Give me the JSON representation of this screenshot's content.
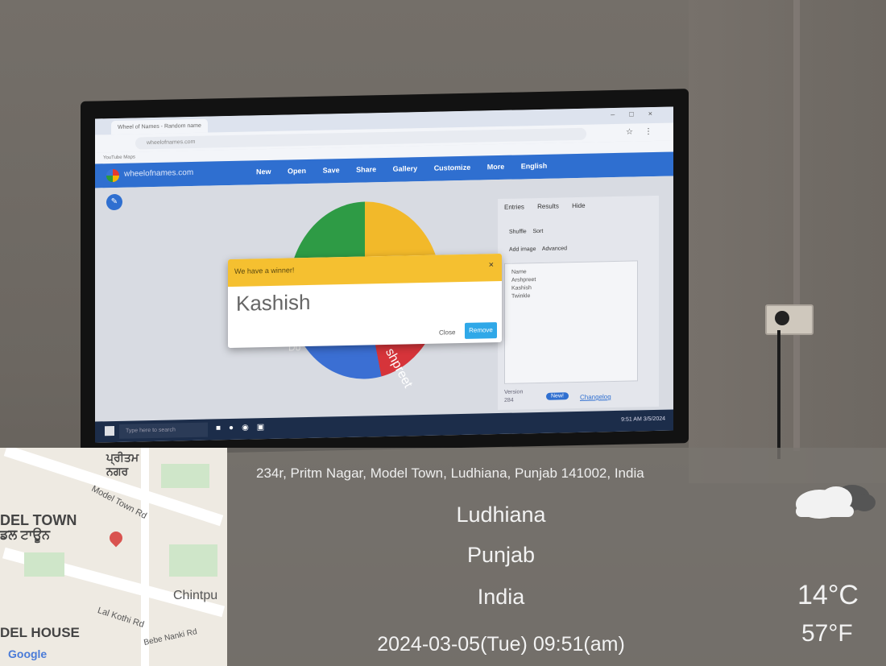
{
  "browser": {
    "tab_title": "Wheel of Names - Random name",
    "url": "wheelofnames.com",
    "bookmarks": "YouTube  Maps"
  },
  "app": {
    "site_name": "wheelofnames.com",
    "menu": [
      "New",
      "Open",
      "Save",
      "Share",
      "Gallery",
      "Customize",
      "More",
      "English"
    ]
  },
  "panel": {
    "tabs": [
      "Entries",
      "Results",
      "Hide"
    ],
    "shuffle": "Shuffle",
    "sort": "Sort",
    "add_image": "Add image",
    "advanced": "Advanced",
    "entries": [
      "Name",
      "Arshpreet",
      "Kashish",
      "Twinkle"
    ],
    "version_label": "Version",
    "version_number": "284",
    "new_badge": "New!",
    "changelog": "Changelog"
  },
  "wheel": {
    "label_visible_1": "shpreet",
    "label_visible_2": "Do"
  },
  "dialog": {
    "title": "We have a winner!",
    "close_x": "×",
    "winner": "Kashish",
    "close_button": "Close",
    "remove_button": "Remove"
  },
  "taskbar": {
    "search_placeholder": "Type here to search",
    "time": "9:51 AM",
    "date": "3/5/2024"
  },
  "map": {
    "labels": [
      "ਪ੍ਰੀਤਮ\nਨਗਰ",
      "DEL TOWN",
      "ਡਲ ਟਾਊਨ",
      "Model Town Rd",
      "Chintpu",
      "Lal Kothi Rd",
      "DEL HOUSE",
      "Bebe Nanki Rd",
      "Google"
    ]
  },
  "overlay": {
    "address": "234r, Pritm Nagar, Model Town, Ludhiana, Punjab 141002, India",
    "city": "Ludhiana",
    "state": "Punjab",
    "country": "India",
    "datetime": "2024-03-05(Tue)   09:51(am)",
    "temp_c": "14°C",
    "temp_f": "57°F"
  }
}
